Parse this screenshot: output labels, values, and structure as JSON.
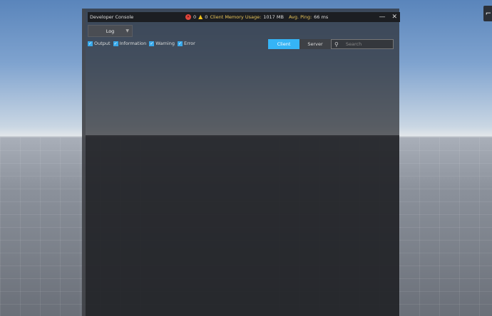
{
  "title": "Developer Console",
  "stats": {
    "errors": "0",
    "warnings": "0",
    "memory_label": "Client Memory Usage:",
    "memory_value": "1017 MB",
    "ping_label": "Avg. Ping:",
    "ping_value": "66 ms"
  },
  "window_controls": {
    "minimize": "—",
    "close": "✕"
  },
  "log_dropdown": {
    "selected": "Log"
  },
  "filters": [
    {
      "label": "Output"
    },
    {
      "label": "Information"
    },
    {
      "label": "Warning"
    },
    {
      "label": "Error"
    }
  ],
  "tabs": [
    {
      "label": "Client"
    },
    {
      "label": "Server"
    }
  ],
  "search": {
    "placeholder": "Search"
  },
  "corner_button": {
    "icon": "menu-icon"
  }
}
